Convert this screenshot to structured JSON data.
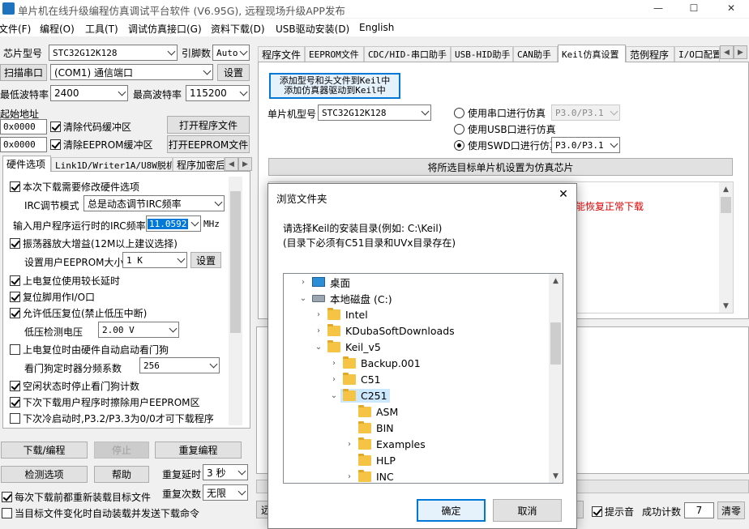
{
  "window": {
    "title": "单片机在线升级编程仿真调试平台软件 (V6.95G), 远程现场升级APP发布",
    "minimize": "—",
    "maximize": "☐",
    "close": "✕"
  },
  "menu": [
    "文件(F)",
    "编程(O)",
    "工具(T)",
    "调试仿真接口(G)",
    "资料下载(D)",
    "USB驱动安装(D)",
    "English"
  ],
  "left": {
    "chip_label": "芯片型号",
    "chip_value": "STC32G12K128",
    "pins_label": "引脚数",
    "pins_value": "Auto",
    "scan_label": "扫描串口",
    "port_value": "(COM1) 通信端口",
    "settings_btn": "设置",
    "min_baud_label": "最低波特率",
    "min_baud": "2400",
    "max_baud_label": "最高波特率",
    "max_baud": "115200",
    "start_addr_label": "起始地址",
    "addr1": "0x0000",
    "clear_code_label": "清除代码缓冲区",
    "open_prog_btn": "打开程序文件",
    "addr2": "0x0000",
    "clear_eeprom_label": "清除EEPROM缓冲区",
    "open_eeprom_btn": "打开EEPROM文件",
    "tabs": [
      "硬件选项",
      "Link1D/Writer1A/U8W脱机",
      "程序加密后"
    ],
    "opts": {
      "o1": "本次下载需要修改硬件选项",
      "irc_mode_label": "IRC调节模式",
      "irc_mode": "总是动态调节IRC频率",
      "irc_freq_label": "输入用户程序运行时的IRC频率",
      "irc_freq": "11.0592",
      "mhz": "MHz",
      "o2": "振荡器放大增益(12M以上建议选择)",
      "eeprom_size_label": "设置用户EEPROM大小",
      "eeprom_size": "1  K",
      "eeprom_btn": "设置",
      "o3": "上电复位使用较长延时",
      "o4": "复位脚用作I/O口",
      "o5": "允许低压复位(禁止低压中断)",
      "lvd_label": "低压检测电压",
      "lvd": "2.00 V",
      "o6": "上电复位时由硬件自动启动看门狗",
      "wdt_label": "看门狗定时器分频系数",
      "wdt": "256",
      "o7": "空闲状态时停止看门狗计数",
      "o8": "下次下载用户程序时擦除用户EEPROM区",
      "o9": "下次冷启动时,P3.2/P3.3为0/0才可下载程序"
    },
    "download_btn": "下载/编程",
    "stop_btn": "停止",
    "reprogram_btn": "重复编程",
    "detect_btn": "检测选项",
    "help_btn": "帮助",
    "repeat_delay_label": "重复延时",
    "repeat_delay": "3 秒",
    "repeat_count_label": "重复次数",
    "repeat_count": "无限",
    "reload_label": "每次下载前都重新装载目标文件",
    "auto_send_label": "当目标文件变化时自动装载并发送下载命令"
  },
  "right": {
    "tabs": [
      "程序文件",
      "EEPROM文件",
      "CDC/HID-串口助手",
      "USB-HID助手",
      "CAN助手",
      "Keil仿真设置",
      "范例程序",
      "I/O口配置"
    ],
    "add_keil_line1": "添加型号和头文件到Keil中",
    "add_keil_line2": "添加仿真器驱动到Keil中",
    "mcu_label": "单片机型号",
    "mcu_value": "STC32G12K128",
    "r1": "使用串口进行仿真",
    "r1_combo": "P3.0/P3.1",
    "r2": "使用USB口进行仿真",
    "r3": "使用SWD口进行仿真",
    "r3_combo": "P3.0/P3.1",
    "set_chip_btn": "将所选目标单片机设置为仿真芯片",
    "red_text": "能恢复正常下载",
    "bottom_btn_partial": "远",
    "beep_label": "提示音",
    "success_label": "成功计数",
    "success_count": "7",
    "clear_btn": "清零"
  },
  "dialog": {
    "title": "浏览文件夹",
    "line1": "请选择Keil的安装目录(例如: C:\\Keil)",
    "line2": "(目录下必须有C51目录和UVx目录存在)",
    "tree": [
      {
        "label": "桌面",
        "chev": "›",
        "icon": "desktop"
      },
      {
        "label": "本地磁盘 (C:)",
        "chev": "⌄",
        "icon": "drive"
      },
      {
        "label": "Intel",
        "chev": "›",
        "icon": "folder"
      },
      {
        "label": "KDubaSoftDownloads",
        "chev": "›",
        "icon": "folder"
      },
      {
        "label": "Keil_v5",
        "chev": "⌄",
        "icon": "folder"
      },
      {
        "label": "Backup.001",
        "chev": "›",
        "icon": "folder"
      },
      {
        "label": "C51",
        "chev": "›",
        "icon": "folder"
      },
      {
        "label": "C251",
        "chev": "⌄",
        "icon": "folder",
        "selected": true
      },
      {
        "label": "ASM",
        "chev": "",
        "icon": "folder"
      },
      {
        "label": "BIN",
        "chev": "",
        "icon": "folder"
      },
      {
        "label": "Examples",
        "chev": "›",
        "icon": "folder"
      },
      {
        "label": "HLP",
        "chev": "",
        "icon": "folder"
      },
      {
        "label": "INC",
        "chev": "›",
        "icon": "folder"
      }
    ],
    "ok": "确定",
    "cancel": "取消",
    "close": "✕"
  },
  "colors": {
    "accent": "#0078d7",
    "selection": "#cce8ff",
    "red": "#e00000",
    "folder": "#f6c445"
  }
}
